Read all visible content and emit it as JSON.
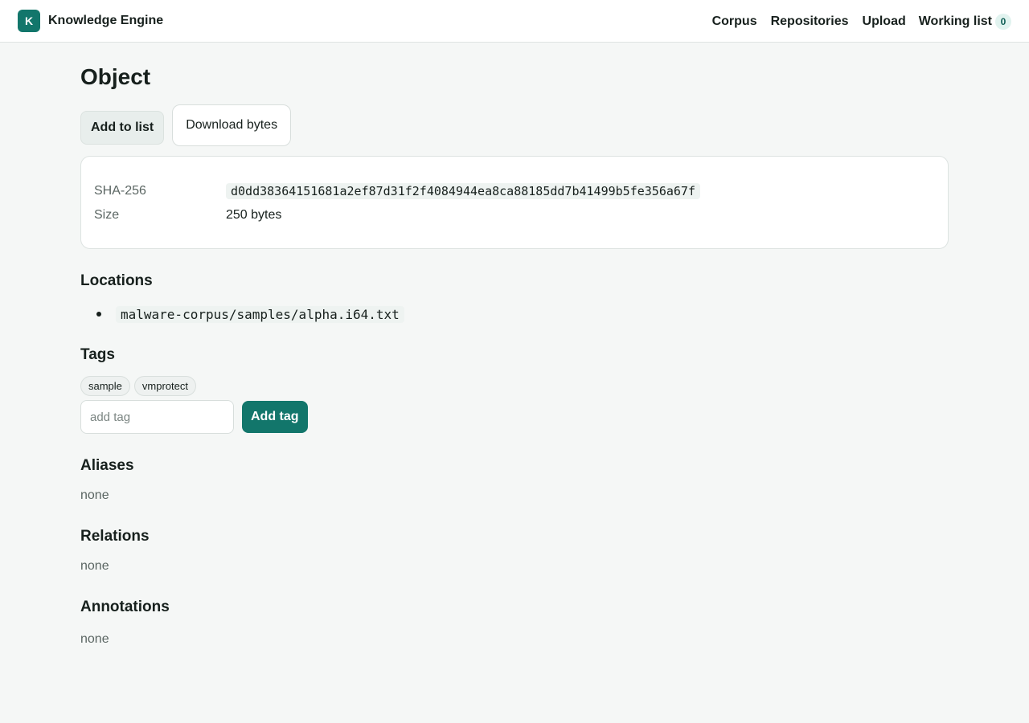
{
  "brand": {
    "logo_letter": "K",
    "name": "Knowledge Engine"
  },
  "nav": {
    "corpus": "Corpus",
    "repositories": "Repositories",
    "upload": "Upload",
    "working_list": "Working list",
    "working_list_count": "0"
  },
  "page": {
    "title": "Object"
  },
  "actions": {
    "add_to_list": "Add to list",
    "download_bytes": "Download bytes"
  },
  "details": {
    "sha_label": "SHA-256",
    "sha_value": "d0dd38364151681a2ef87d31f2f4084944ea8ca88185dd7b41499b5fe356a67f",
    "size_label": "Size",
    "size_value": "250 bytes"
  },
  "locations": {
    "title": "Locations",
    "items": [
      "malware-corpus/samples/alpha.i64.txt"
    ]
  },
  "tags": {
    "title": "Tags",
    "items": [
      "sample",
      "vmprotect"
    ],
    "input_placeholder": "add tag",
    "input_value": "",
    "add_button": "Add tag"
  },
  "aliases": {
    "title": "Aliases",
    "empty": "none"
  },
  "relations": {
    "title": "Relations",
    "empty": "none"
  },
  "annotations": {
    "title": "Annotations",
    "empty": "none"
  },
  "colors": {
    "accent": "#12766b",
    "background": "#f5f7f6",
    "badge_bg": "#e1f3ef"
  }
}
